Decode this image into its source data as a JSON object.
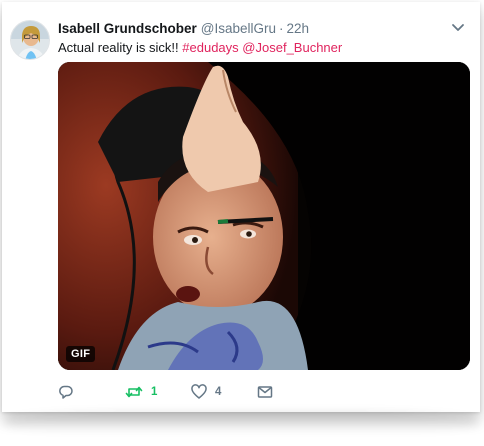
{
  "tweet": {
    "author_name": "Isabell Grundschober",
    "handle": "@IsabellGru",
    "separator": "·",
    "time": "22h",
    "text_plain": "Actual reality is sick!!",
    "hashtag": "#edudays",
    "mention": "@Josef_Buchner",
    "media_badge": "GIF",
    "retweet_count": "1",
    "like_count": "4"
  },
  "icons": {
    "reply": "reply-icon",
    "retweet": "retweet-icon",
    "like": "heart-icon",
    "dm": "mail-icon",
    "menu": "chevron-down-icon"
  },
  "colors": {
    "link": "#e0245e",
    "retweet_active": "#17bf63",
    "muted": "#657786"
  }
}
